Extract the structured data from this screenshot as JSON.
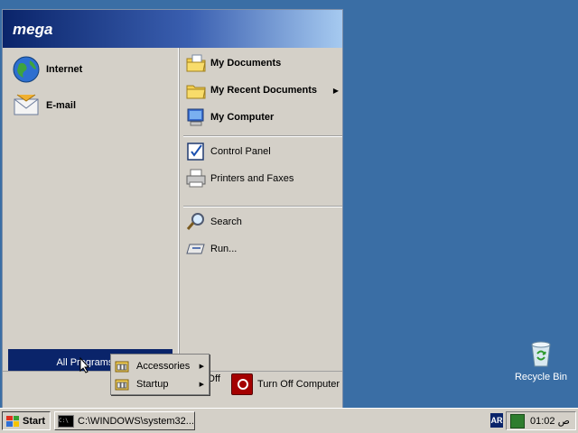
{
  "desktop": {
    "recycle_bin_label": "Recycle Bin"
  },
  "start_menu": {
    "user_name": "mega",
    "pinned": [
      {
        "label": "Internet",
        "icon": "internet-globe-icon"
      },
      {
        "label": "E-mail",
        "icon": "email-icon"
      }
    ],
    "all_programs_label": "All Programs",
    "right_items": [
      {
        "label": "My Documents",
        "icon": "my-documents-folder-icon",
        "bold": true
      },
      {
        "label": "My Recent Documents",
        "icon": "recent-documents-folder-icon",
        "bold": true,
        "submenu": true
      },
      {
        "label": "My Computer",
        "icon": "my-computer-icon",
        "bold": true
      },
      {
        "label": "Control Panel",
        "icon": "control-panel-icon",
        "bold": false
      },
      {
        "label": "Printers and Faxes",
        "icon": "printer-icon",
        "bold": false
      },
      {
        "label": "Search",
        "icon": "search-icon",
        "bold": false
      },
      {
        "label": "Run...",
        "icon": "run-icon",
        "bold": false
      }
    ],
    "log_off_label": "Log Off",
    "turn_off_label": "Turn Off Computer"
  },
  "all_programs_submenu": {
    "items": [
      {
        "label": "Accessories",
        "icon": "program-group-icon"
      },
      {
        "label": "Startup",
        "icon": "program-group-icon"
      }
    ]
  },
  "taskbar": {
    "start_label": "Start",
    "window_button_label": "C:\\WINDOWS\\system32...",
    "language_indicator": "AR",
    "clock": "01:02 ص"
  },
  "colors": {
    "desktop": "#3a6ea5",
    "header_dark": "#0a246a",
    "selection": "#0a246a",
    "face": "#d4d0c8"
  }
}
